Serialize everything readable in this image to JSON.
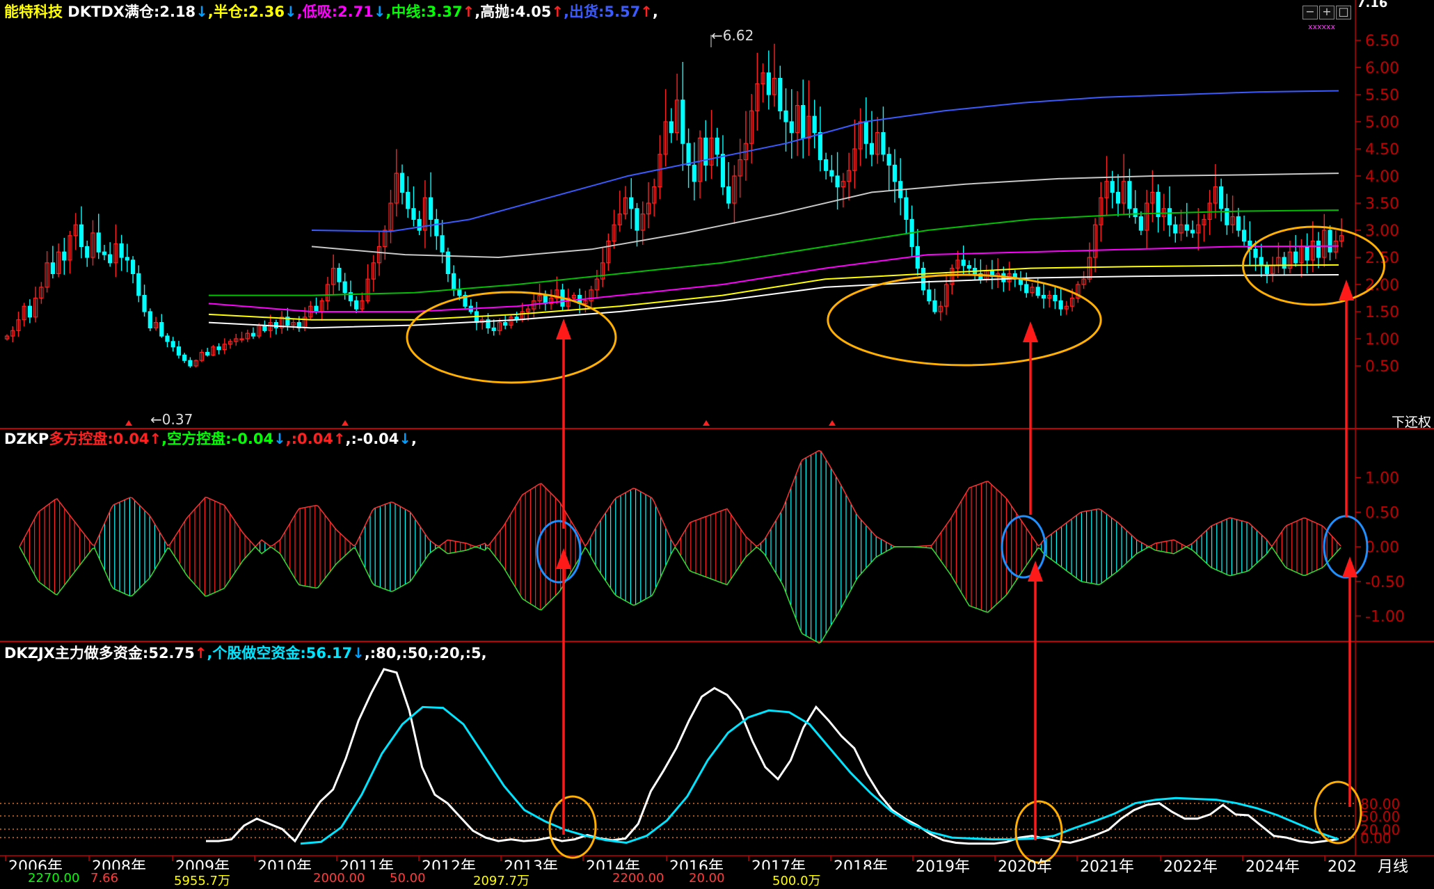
{
  "header_main": {
    "stock": "能特科技",
    "items": [
      {
        "text": " DKTDX满仓:2.18",
        "arrow": "↓",
        "color": "#ffffff",
        "acolor": "#00a0ff"
      },
      {
        "text": ",半仓:2.36",
        "arrow": "↓",
        "color": "#ffff00",
        "acolor": "#00a0ff"
      },
      {
        "text": ",低吸:2.71",
        "arrow": "↓",
        "color": "#ff00ff",
        "acolor": "#00a0ff"
      },
      {
        "text": ",中线:3.37",
        "arrow": "↑",
        "color": "#00ff00",
        "acolor": "#ff2020"
      },
      {
        "text": ",高抛:4.05",
        "arrow": "↑",
        "color": "#ffffff",
        "acolor": "#ff2020"
      },
      {
        "text": ",出货:5.57",
        "arrow": "↑",
        "color": "#3b5bff",
        "acolor": "#ff2020"
      },
      {
        "text": ",",
        "arrow": "",
        "color": "#ffffff",
        "acolor": "#ffffff"
      }
    ]
  },
  "header_dzkp": {
    "items": [
      {
        "text": "DZKP",
        "arrow": "",
        "color": "#ffffff",
        "acolor": "#fff"
      },
      {
        "text": "多方控盘:0.04",
        "arrow": "↑",
        "color": "#ff2020",
        "acolor": "#ff2020"
      },
      {
        "text": ",空方控盘:-0.04",
        "arrow": "↓",
        "color": "#00ff00",
        "acolor": "#00a0ff"
      },
      {
        "text": ",:0.04",
        "arrow": "↑",
        "color": "#ff2020",
        "acolor": "#ff2020"
      },
      {
        "text": ",:-0.04",
        "arrow": "↓",
        "color": "#ffffff",
        "acolor": "#00a0ff"
      },
      {
        "text": ",",
        "arrow": "",
        "color": "#ffffff",
        "acolor": "#fff"
      }
    ]
  },
  "header_dkzjx": {
    "items": [
      {
        "text": "DKZJX主力做多资金:52.75",
        "arrow": "↑",
        "color": "#ffffff",
        "acolor": "#ff2020"
      },
      {
        "text": ",个股做空资金:56.17",
        "arrow": "↓",
        "color": "#00e5ff",
        "acolor": "#00a0ff"
      },
      {
        "text": ",:80,:50,:20,:5,",
        "arrow": "",
        "color": "#ffffff",
        "acolor": "#fff"
      }
    ]
  },
  "top_right_value": "7.16",
  "xxx_mark": "xxxxxx",
  "adjust_label": "下还权",
  "period_label": "月线",
  "window_buttons": [
    "−",
    "+",
    "□"
  ],
  "price_annotations": {
    "high": "6.62",
    "low": "0.37"
  },
  "colors": {
    "up": "#ff2020",
    "down": "#00ffff",
    "grid_red": "#c00000",
    "ellipse": "#ffb000",
    "circle": "#1e90ff",
    "arrow": "#ff1a1a"
  },
  "footer_values": [
    "2270.00",
    "7.66",
    "5955.7万",
    "2000.00",
    "50.00",
    "2097.7万",
    "2200.00",
    "20.00",
    "500.0万"
  ],
  "chart_data": [
    {
      "type": "candlestick",
      "title": "能特科技 月线",
      "period": "monthly",
      "y_ticks": [
        0.5,
        1.0,
        1.5,
        2.0,
        2.5,
        3.0,
        3.5,
        4.0,
        4.5,
        5.0,
        5.5,
        6.0,
        6.5
      ],
      "ylim": [
        0.3,
        7.1
      ],
      "x_labels": [
        "2006年",
        "2008年",
        "2009年",
        "2010年",
        "2011年",
        "2012年",
        "2013年",
        "2014年",
        "2016年",
        "2017年",
        "2018年",
        "2019年",
        "2020年",
        "2021年",
        "2022年",
        "2024年",
        "202"
      ],
      "closes": [
        1.05,
        1.15,
        1.35,
        1.6,
        1.4,
        1.75,
        1.95,
        2.4,
        2.2,
        2.6,
        2.45,
        2.9,
        3.1,
        2.7,
        2.5,
        2.95,
        2.6,
        2.55,
        2.4,
        2.75,
        2.5,
        2.45,
        2.2,
        1.8,
        1.5,
        1.2,
        1.3,
        1.05,
        0.95,
        0.85,
        0.7,
        0.6,
        0.5,
        0.6,
        0.75,
        0.7,
        0.85,
        0.8,
        0.9,
        0.95,
        1.0,
        1.0,
        1.1,
        1.05,
        1.25,
        1.15,
        1.3,
        1.2,
        1.4,
        1.25,
        1.3,
        1.2,
        1.4,
        1.6,
        1.5,
        1.7,
        2.0,
        2.3,
        2.05,
        1.85,
        1.7,
        1.55,
        1.7,
        2.1,
        2.4,
        2.7,
        3.0,
        3.5,
        4.05,
        3.7,
        3.4,
        3.2,
        3.0,
        3.6,
        3.2,
        2.9,
        2.6,
        2.2,
        1.9,
        1.8,
        1.6,
        1.5,
        1.3,
        1.35,
        1.2,
        1.15,
        1.3,
        1.25,
        1.4,
        1.35,
        1.5,
        1.55,
        1.7,
        1.8,
        1.65,
        1.75,
        1.9,
        1.6,
        1.75,
        1.8,
        1.65,
        1.7,
        1.9,
        2.1,
        2.4,
        2.8,
        3.1,
        3.3,
        3.6,
        3.4,
        3.0,
        3.3,
        3.5,
        3.8,
        4.4,
        5.0,
        4.8,
        5.4,
        4.6,
        4.2,
        3.9,
        4.7,
        4.2,
        4.7,
        4.4,
        3.8,
        3.5,
        4.0,
        4.3,
        4.6,
        5.2,
        5.7,
        5.9,
        5.5,
        5.8,
        5.2,
        5.0,
        4.8,
        5.3,
        4.7,
        5.1,
        4.8,
        4.3,
        4.1,
        4.0,
        3.8,
        3.9,
        4.1,
        4.5,
        5.0,
        4.6,
        4.4,
        4.8,
        4.4,
        4.2,
        3.9,
        3.6,
        3.2,
        2.7,
        2.3,
        1.9,
        1.7,
        1.5,
        1.6,
        2.0,
        2.3,
        2.45,
        2.35,
        2.3,
        2.2,
        2.1,
        2.25,
        2.15,
        2.2,
        2.05,
        2.2,
        2.1,
        2.0,
        1.85,
        1.95,
        1.8,
        1.75,
        1.8,
        1.7,
        1.55,
        1.6,
        1.75,
        2.0,
        2.1,
        2.5,
        3.1,
        3.6,
        3.9,
        3.7,
        3.5,
        3.9,
        3.4,
        3.25,
        3.0,
        3.5,
        3.7,
        3.25,
        3.4,
        3.1,
        2.95,
        3.1,
        3.0,
        2.95,
        3.1,
        3.2,
        3.5,
        3.8,
        3.4,
        3.1,
        3.25,
        3.0,
        2.8,
        2.65,
        2.5,
        2.35,
        2.2,
        2.35,
        2.5,
        2.3,
        2.6,
        2.4,
        2.7,
        2.45,
        2.8,
        2.5,
        3.0,
        2.6,
        2.8,
        2.9
      ],
      "annotations": [
        {
          "text": "6.62",
          "type": "high"
        },
        {
          "text": "0.37",
          "type": "low"
        }
      ],
      "overlay_lines": [
        {
          "name": "出货",
          "color": "#3b5bff",
          "values": [
            3.0,
            2.98,
            3.2,
            3.6,
            4.0,
            4.3,
            4.6,
            5.0,
            5.2,
            5.35,
            5.45,
            5.5,
            5.55,
            5.57
          ]
        },
        {
          "name": "高抛",
          "color": "#c8c8c8",
          "values": [
            2.7,
            2.55,
            2.5,
            2.65,
            2.95,
            3.3,
            3.7,
            3.85,
            3.95,
            4.0,
            4.02,
            4.05
          ]
        },
        {
          "name": "中线",
          "color": "#00c000",
          "values": [
            1.8,
            1.8,
            1.85,
            2.0,
            2.2,
            2.4,
            2.7,
            3.0,
            3.2,
            3.3,
            3.35,
            3.37
          ]
        },
        {
          "name": "低吸",
          "color": "#ff00ff",
          "values": [
            1.65,
            1.5,
            1.5,
            1.6,
            1.8,
            2.0,
            2.3,
            2.55,
            2.6,
            2.65,
            2.7,
            2.71
          ]
        },
        {
          "name": "半仓",
          "color": "#ffff00",
          "values": [
            1.45,
            1.35,
            1.35,
            1.45,
            1.6,
            1.8,
            2.1,
            2.2,
            2.3,
            2.33,
            2.35,
            2.36
          ]
        },
        {
          "name": "满仓",
          "color": "#ffffff",
          "values": [
            1.3,
            1.2,
            1.25,
            1.35,
            1.5,
            1.7,
            1.95,
            2.05,
            2.12,
            2.15,
            2.17,
            2.18
          ]
        }
      ]
    },
    {
      "type": "bar",
      "title": "DZKP",
      "y_ticks": [
        -1.0,
        -0.5,
        0.0,
        0.5,
        1.0
      ],
      "ylim": [
        -1.35,
        1.35
      ],
      "envelope": [
        0,
        0.5,
        0.7,
        0.35,
        0,
        -0.6,
        -0.72,
        -0.45,
        0,
        0.42,
        0.72,
        0.6,
        0.2,
        -0.1,
        0.1,
        0.55,
        0.6,
        0.25,
        0,
        -0.55,
        -0.65,
        -0.5,
        -0.1,
        0.1,
        0.05,
        -0.05,
        0.3,
        0.75,
        0.92,
        0.65,
        0.2,
        -0.3,
        -0.7,
        -0.85,
        -0.7,
        -0.1,
        0.35,
        0.45,
        0.55,
        0.15,
        -0.1,
        -0.55,
        -1.25,
        -1.4,
        -0.95,
        -0.45,
        -0.15,
        0,
        0,
        0.02,
        0.4,
        0.85,
        0.95,
        0.7,
        0.3,
        -0.1,
        -0.3,
        -0.5,
        -0.55,
        -0.35,
        -0.1,
        0.05,
        0.1,
        -0.05,
        -0.3,
        -0.42,
        -0.35,
        -0.1,
        0.3,
        0.42,
        0.3,
        0.0
      ],
      "series": [
        {
          "name": "多方控盘",
          "color": "#ff2020"
        },
        {
          "name": "空方控盘",
          "color": "#00e000"
        }
      ]
    },
    {
      "type": "line",
      "title": "DKZJX",
      "reference_levels": [
        80,
        50,
        20,
        5
      ],
      "ylim": [
        0,
        1100
      ],
      "series": [
        {
          "name": "主力做多资金",
          "color": "#ffffff",
          "values": [
            20,
            20,
            30,
            110,
            150,
            120,
            90,
            20,
            140,
            250,
            320,
            500,
            720,
            880,
            1020,
            1000,
            780,
            450,
            290,
            240,
            160,
            80,
            40,
            20,
            30,
            20,
            25,
            40,
            20,
            30,
            55,
            35,
            25,
            35,
            120,
            310,
            430,
            560,
            720,
            860,
            910,
            870,
            780,
            600,
            450,
            380,
            490,
            680,
            800,
            720,
            630,
            560,
            410,
            290,
            200,
            150,
            110,
            60,
            25,
            10,
            5,
            5,
            5,
            15,
            40,
            50,
            35,
            20,
            10,
            30,
            55,
            85,
            150,
            200,
            230,
            240,
            190,
            150,
            150,
            175,
            230,
            175,
            170,
            110,
            50,
            40,
            20,
            10,
            20,
            30
          ]
        },
        {
          "name": "个股做空资金",
          "color": "#00e5ff",
          "values": [
            5,
            15,
            100,
            290,
            530,
            700,
            800,
            795,
            700,
            520,
            340,
            200,
            135,
            85,
            50,
            25,
            10,
            50,
            140,
            280,
            490,
            650,
            740,
            780,
            770,
            700,
            560,
            420,
            300,
            195,
            120,
            70,
            40,
            35,
            30,
            30,
            35,
            50,
            95,
            135,
            180,
            240,
            260,
            270,
            265,
            260,
            240,
            210,
            170,
            120,
            70,
            30
          ]
        }
      ]
    }
  ]
}
